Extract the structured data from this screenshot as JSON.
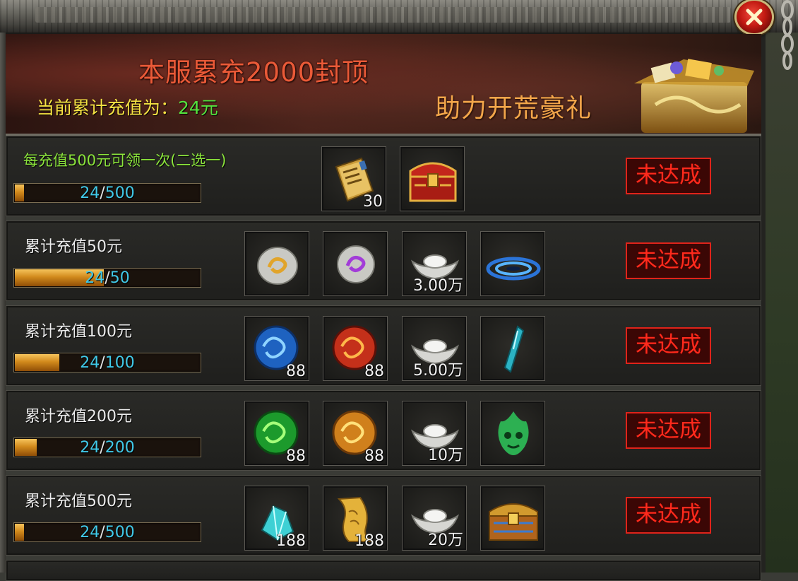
{
  "window": {
    "close_label": "×"
  },
  "banner": {
    "title": "本服累充2000封顶",
    "subtitle": "助力开荒豪礼",
    "current_label": "当前累计充值为：",
    "current_amount": "24元"
  },
  "tiers": [
    {
      "label": "每充值500元可领一次(二选一)",
      "progress_current": "24",
      "progress_sep": "/",
      "progress_target": "500",
      "progress_fraction": 0.048,
      "status": "未达成",
      "items": [
        {
          "icon": "skill-book-icon",
          "qty": "30"
        },
        {
          "icon": "red-treasure-chest-icon",
          "qty": ""
        }
      ]
    },
    {
      "label": "累计充值50元",
      "progress_current": "24",
      "progress_sep": "/",
      "progress_target": "50",
      "progress_fraction": 0.48,
      "status": "未达成",
      "items": [
        {
          "icon": "silver-stone-gold-rune-icon",
          "qty": ""
        },
        {
          "icon": "silver-stone-purple-rune-icon",
          "qty": ""
        },
        {
          "icon": "silver-ingot-icon",
          "qty": "3.00万"
        },
        {
          "icon": "blue-portal-icon",
          "qty": ""
        }
      ]
    },
    {
      "label": "累计充值100元",
      "progress_current": "24",
      "progress_sep": "/",
      "progress_target": "100",
      "progress_fraction": 0.24,
      "status": "未达成",
      "items": [
        {
          "icon": "blue-dragon-orb-icon",
          "qty": "88"
        },
        {
          "icon": "red-dragon-orb-icon",
          "qty": "88"
        },
        {
          "icon": "silver-ingot-icon",
          "qty": "5.00万"
        },
        {
          "icon": "crystal-shard-icon",
          "qty": ""
        }
      ]
    },
    {
      "label": "累计充值200元",
      "progress_current": "24",
      "progress_sep": "/",
      "progress_target": "200",
      "progress_fraction": 0.12,
      "status": "未达成",
      "items": [
        {
          "icon": "green-dragon-orb-icon",
          "qty": "88"
        },
        {
          "icon": "orange-dragon-orb-icon",
          "qty": "88"
        },
        {
          "icon": "silver-ingot-icon",
          "qty": "10万"
        },
        {
          "icon": "green-ghost-flame-icon",
          "qty": ""
        }
      ]
    },
    {
      "label": "累计充值500元",
      "progress_current": "24",
      "progress_sep": "/",
      "progress_target": "500",
      "progress_fraction": 0.048,
      "status": "未达成",
      "items": [
        {
          "icon": "cyan-crystal-shard-icon",
          "qty": "188"
        },
        {
          "icon": "golden-scroll-icon",
          "qty": "188"
        },
        {
          "icon": "silver-ingot-icon",
          "qty": "20万"
        },
        {
          "icon": "golden-treasure-chest-icon",
          "qty": ""
        }
      ]
    }
  ],
  "colors": {
    "title": "#ea5a38",
    "subtitle": "#f3a64a",
    "current_label": "#f5e243",
    "current_amount": "#55e23e",
    "special_label": "#8be43c",
    "progress_value": "#41c9e8",
    "status_red": "#ff2a1c"
  }
}
